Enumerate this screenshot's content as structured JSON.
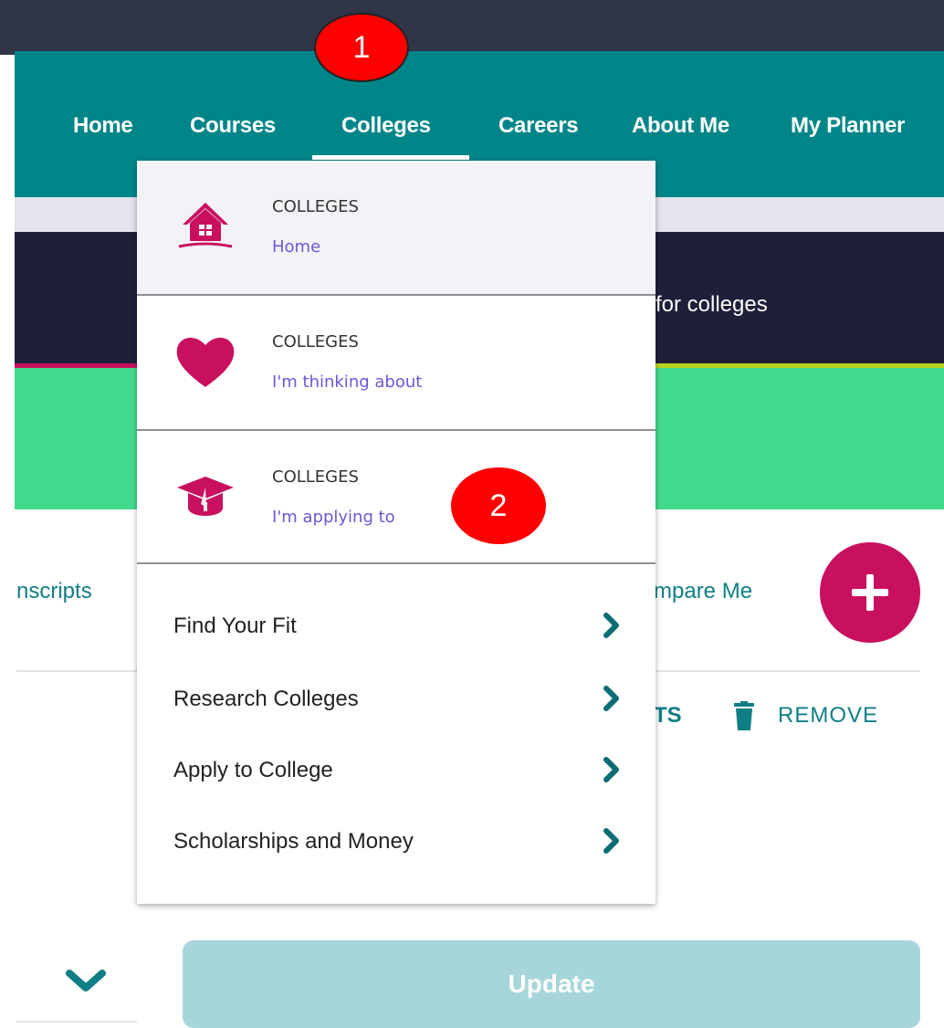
{
  "nav": {
    "items": [
      {
        "label": "Home"
      },
      {
        "label": "Courses"
      },
      {
        "label": "Colleges"
      },
      {
        "label": "Careers"
      },
      {
        "label": "About Me"
      },
      {
        "label": "My Planner"
      }
    ],
    "active": "Colleges"
  },
  "banner": {
    "partial_text": "for colleges"
  },
  "tabs": {
    "left_partial": "nscripts",
    "right_partial": "mpare Me"
  },
  "actions": {
    "pts_partial": "PTS",
    "remove_label": "REMOVE",
    "update_label": "Update"
  },
  "dropdown": {
    "cards": [
      {
        "caption": "COLLEGES",
        "link": "Home",
        "icon": "house-icon"
      },
      {
        "caption": "COLLEGES",
        "link": "I'm thinking about",
        "icon": "heart-icon"
      },
      {
        "caption": "COLLEGES",
        "link": "I'm applying to",
        "icon": "graduation-cap-icon"
      }
    ],
    "rows": [
      {
        "label": "Find Your Fit"
      },
      {
        "label": "Research Colleges"
      },
      {
        "label": "Apply to College"
      },
      {
        "label": "Scholarships and Money"
      }
    ]
  },
  "callouts": {
    "one": "1",
    "two": "2"
  },
  "colors": {
    "nav_teal": "#008589",
    "topbar": "#303548",
    "accent_pink": "#c8105f",
    "green_band": "#43d98c",
    "dark_band": "#1f1f3a",
    "link_purple": "#6d57d6",
    "callout_red": "#ff0000",
    "update_button": "#a6d6da"
  }
}
